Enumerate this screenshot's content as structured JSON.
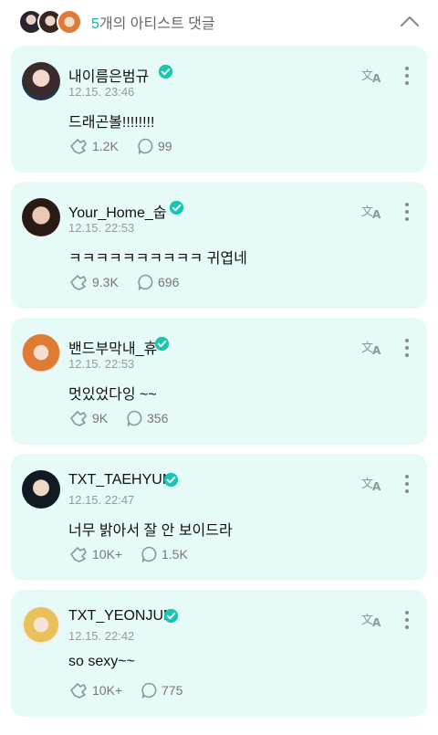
{
  "header": {
    "count": "5",
    "title_suffix": "개의 아티스트 댓글"
  },
  "colors": {
    "accent": "#17b3a2",
    "card_bg": "#e6fbf7",
    "verified": "#1bc5b2"
  },
  "icons": {
    "like": "reaction-icon",
    "reply": "speech-bubble-icon",
    "translate": "translate-icon",
    "more": "more-vertical-icon",
    "collapse": "chevron-up-icon",
    "verified": "verified-badge-icon"
  },
  "comments": [
    {
      "name": "내이름은범규",
      "time": "12.15. 23:46",
      "text": "드래곤볼!!!!!!!!",
      "likes": "1.2K",
      "replies": "99"
    },
    {
      "name": "Your_Home_숩",
      "time": "12.15. 22:53",
      "text": "ㅋㅋㅋㅋㅋㅋㅋㅋㅋㅋ 귀엽네",
      "likes": "9.3K",
      "replies": "696"
    },
    {
      "name": "밴드부막내_휴",
      "time": "12.15. 22:53",
      "text": "멋있었다잉 ~~",
      "likes": "9K",
      "replies": "356"
    },
    {
      "name": "TXT_TAEHYUN",
      "time": "12.15. 22:47",
      "text": "너무 밝아서 잘 안 보이드라",
      "likes": "10K+",
      "replies": "1.5K"
    },
    {
      "name": "TXT_YEONJUN",
      "time": "12.15. 22:42",
      "text": "so sexy~~",
      "likes": "10K+",
      "replies": "775"
    }
  ]
}
